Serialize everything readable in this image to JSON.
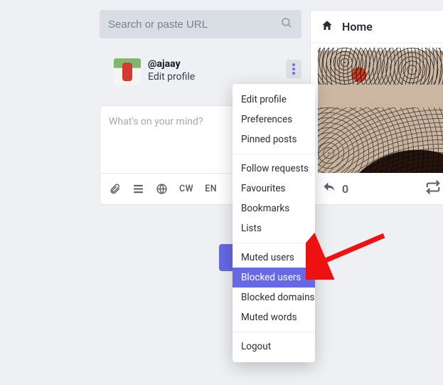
{
  "search": {
    "placeholder": "Search or paste URL"
  },
  "profile": {
    "username": "@ajaay",
    "edit_label": "Edit profile"
  },
  "compose": {
    "placeholder": "What's on your mind?",
    "toolbar": {
      "cw": "CW",
      "lang": "EN"
    }
  },
  "column": {
    "title": "Home"
  },
  "actions": {
    "reply_count": "0"
  },
  "menu": {
    "group1": [
      "Edit profile",
      "Preferences",
      "Pinned posts"
    ],
    "group2": [
      "Follow requests",
      "Favourites",
      "Bookmarks",
      "Lists"
    ],
    "group3": [
      "Muted users",
      "Blocked users",
      "Blocked domains",
      "Muted words"
    ],
    "group4": [
      "Logout"
    ],
    "highlighted": "Blocked users"
  }
}
